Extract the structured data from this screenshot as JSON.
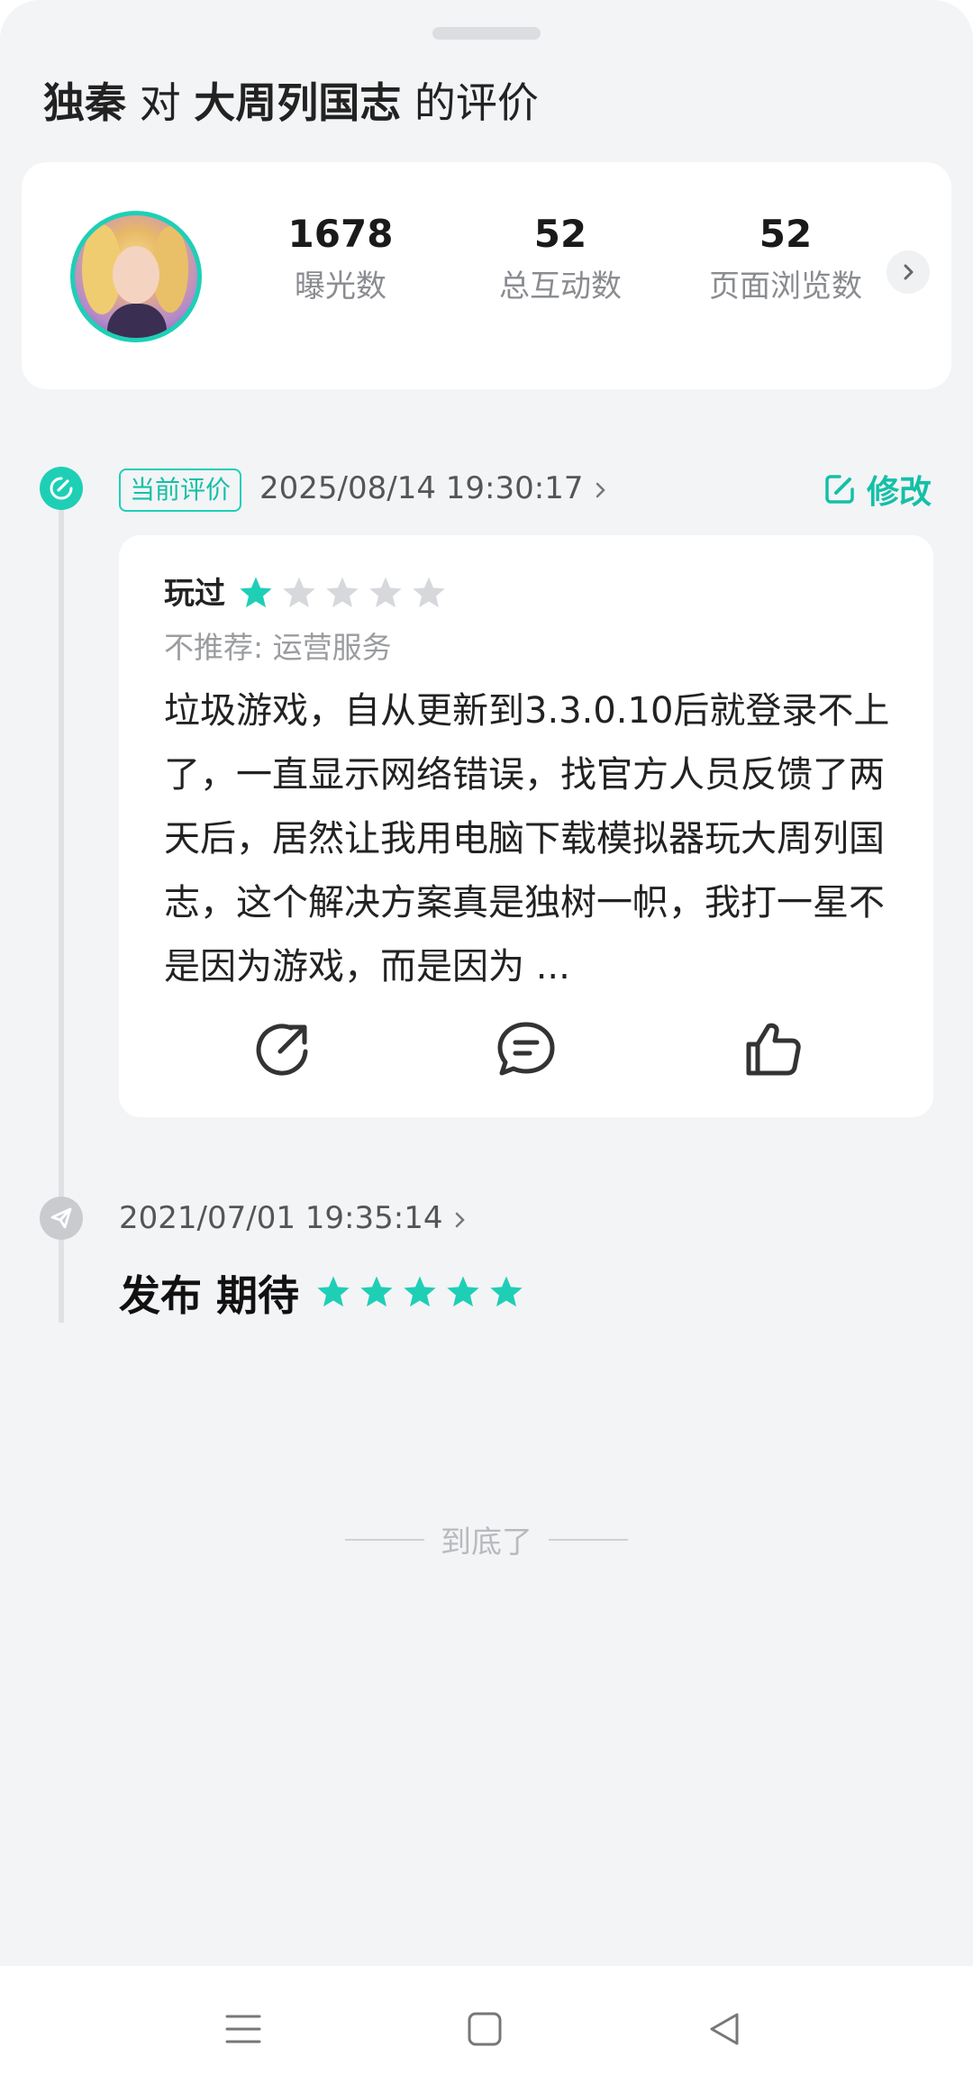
{
  "header": {
    "user": "独秦",
    "connector": "对",
    "game": "大周列国志",
    "suffix": "的评价"
  },
  "stats": [
    {
      "value": "1678",
      "label": "曝光数"
    },
    {
      "value": "52",
      "label": "总互动数"
    },
    {
      "value": "52",
      "label": "页面浏览数"
    }
  ],
  "current_review": {
    "tag": "当前评价",
    "time": "2025/08/14 19:30:17",
    "edit_label": "修改",
    "status": "玩过",
    "rating": 1,
    "rating_max": 5,
    "not_recommend": "不推荐: 运营服务",
    "content": "垃圾游戏，自从更新到3.3.0.10后就登录不上了，一直显示网络错误，找官方人员反馈了两天后，居然让我用电脑下载模拟器玩大周列国志，这个解决方案真是独树一帜，我打一星不是因为游戏，而是因为 ..."
  },
  "earlier_review": {
    "time": "2021/07/01 19:35:14",
    "label": "发布 期待",
    "rating": 5,
    "rating_max": 5
  },
  "end_text": "到底了",
  "colors": {
    "accent": "#1ecfb6",
    "star_empty": "#d6d8db",
    "background": "#f3f4f6"
  }
}
